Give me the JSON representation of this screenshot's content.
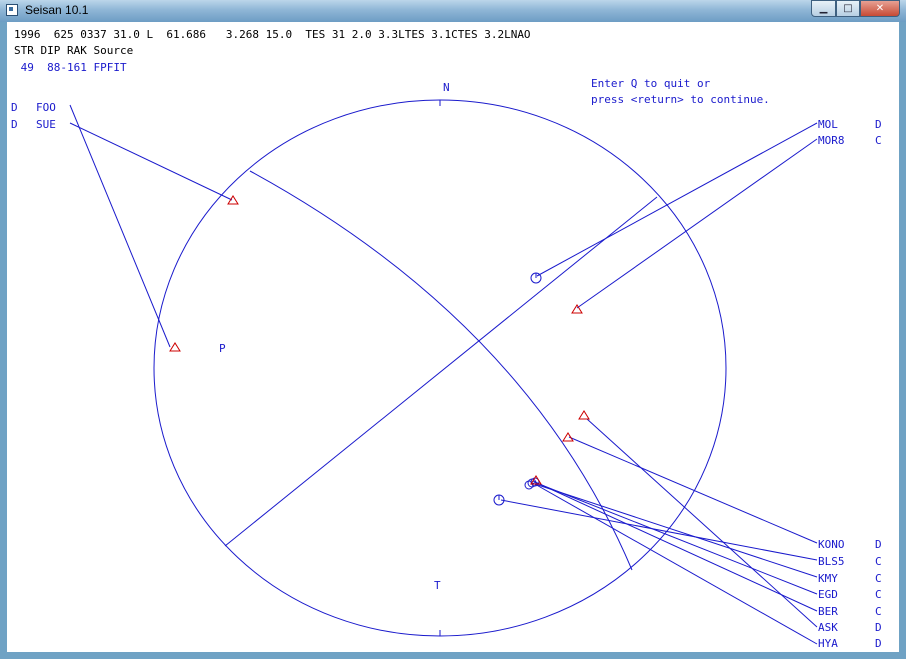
{
  "window": {
    "title": "Seisan 10.1",
    "minimize_glyph": "▁",
    "maximize_glyph": "□",
    "close_glyph": "✕"
  },
  "header": {
    "line1": "1996  625 0337 31.0 L  61.686   3.268 15.0  TES 31 2.0 3.3LTES 3.1CTES 3.2LNAO",
    "line2": "STR DIP RAK Source",
    "line3": " 49  88-161 FPFIT"
  },
  "prompt": {
    "line1": "Enter Q to quit or",
    "line2": "press <return> to continue."
  },
  "plot": {
    "north_label": "N",
    "p_label": "P",
    "t_label": "T"
  },
  "stations_left": [
    {
      "polarity": "D",
      "name": "FOO"
    },
    {
      "polarity": "D",
      "name": "SUE"
    }
  ],
  "stations_right_top": [
    {
      "name": "MOL",
      "polarity": "D"
    },
    {
      "name": "MOR8",
      "polarity": "C"
    }
  ],
  "stations_right_bottom": [
    {
      "name": "KONO",
      "polarity": "D"
    },
    {
      "name": "BLS5",
      "polarity": "C"
    },
    {
      "name": "KMY",
      "polarity": "C"
    },
    {
      "name": "EGD",
      "polarity": "C"
    },
    {
      "name": "BER",
      "polarity": "C"
    },
    {
      "name": "ASK",
      "polarity": "D"
    },
    {
      "name": "HYA",
      "polarity": "D"
    }
  ],
  "colors": {
    "plot_blue": "#1a1acc",
    "dilatation_red": "#cc0000",
    "text_black": "#000000"
  }
}
